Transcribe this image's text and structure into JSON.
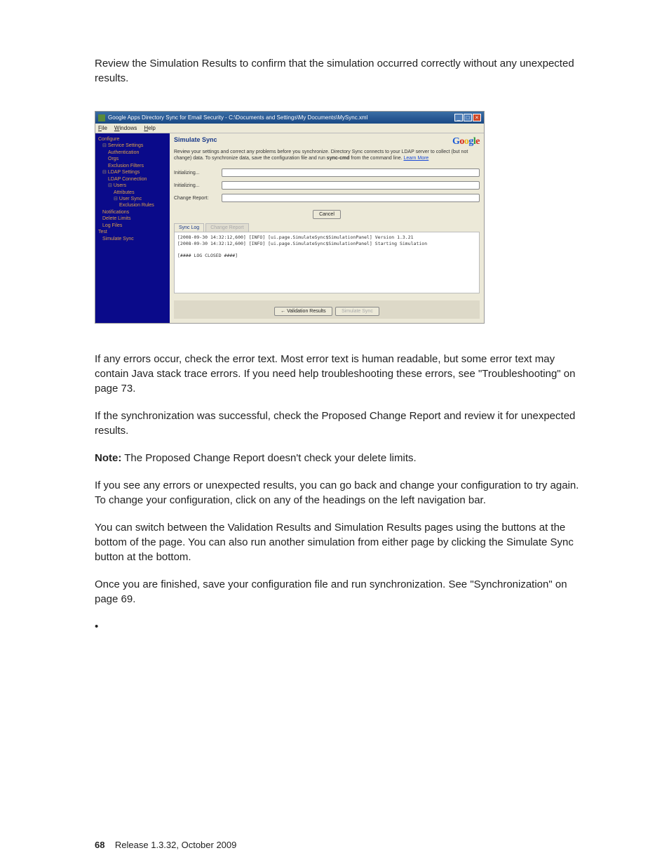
{
  "intro": "Review the Simulation Results to confirm that the simulation occurred correctly without any unexpected results.",
  "screenshot": {
    "title": "Google Apps Directory Sync for Email Security - C:\\Documents and Settings\\My Documents\\MySync.xml",
    "menubar": {
      "file": "File",
      "windows": "Windows",
      "help": "Help"
    },
    "sidebar": {
      "configure": "Configure",
      "service_settings": "Service Settings",
      "authentication": "Authentication",
      "orgs": "Orgs",
      "exclusion_filters": "Exclusion Filters",
      "ldap_settings": "LDAP Settings",
      "ldap_connection": "LDAP Connection",
      "users": "Users",
      "attributes": "Attributes",
      "user_sync": "User Sync",
      "exclusion_rules": "Exclusion Rules",
      "notifications": "Notifications",
      "delete_limits": "Delete Limits",
      "log_files": "Log Files",
      "test": "Test",
      "simulate_sync": "Simulate Sync"
    },
    "content": {
      "title": "Simulate Sync",
      "desc_pre": "Review your settings and correct any problems before you synchronize. Directory Sync connects to your LDAP server to collect (but not change) data. To synchronize data, save the configuration file and run ",
      "desc_bold": "sync-cmd",
      "desc_post": " from the command line. ",
      "learn_more": "Learn More",
      "prog1": "Initializing...",
      "prog2": "Initializing...",
      "prog3": "Change Report:",
      "cancel": "Cancel",
      "tab_active": "Sync Log",
      "tab_inactive": "Change Report",
      "log_line1": "[2008-09-30 14:32:12,600] [INFO] [ui.page.SimulateSync$SimulationPanel] Version 1.3.21",
      "log_line2": "[2008-09-30 14:32:12,600] [INFO] [ui.page.SimulateSync$SimulationPanel] Starting Simulation",
      "log_line3": "[#### LOG CLOSED ####]",
      "btn_validation": "Validation Results",
      "btn_simulate": "Simulate Sync"
    }
  },
  "body": {
    "p1": "If any errors occur, check the error text. Most error text is human readable, but some error text may contain Java stack trace errors. If you need help troubleshooting these errors, see \"Troubleshooting\" on page 73.",
    "p2": "If the synchronization was successful, check the Proposed Change Report and review it for unexpected results.",
    "note_label": "Note:",
    "note_text": " The Proposed Change Report doesn't check your delete limits.",
    "p3": "If you see any errors or unexpected results, you can go back and change your configuration to try again. To change your configuration, click on any of the headings on the left navigation bar.",
    "p4": "You can switch between the Validation Results and Simulation Results pages using the buttons at the bottom of the page. You can also run another simulation from either page by clicking the Simulate Sync button at the bottom.",
    "p5": "Once you are finished, save your configuration file and run synchronization. See \"Synchronization\" on page 69.",
    "bullet": "•"
  },
  "footer": {
    "page": "68",
    "release": "Release 1.3.32, October 2009"
  }
}
